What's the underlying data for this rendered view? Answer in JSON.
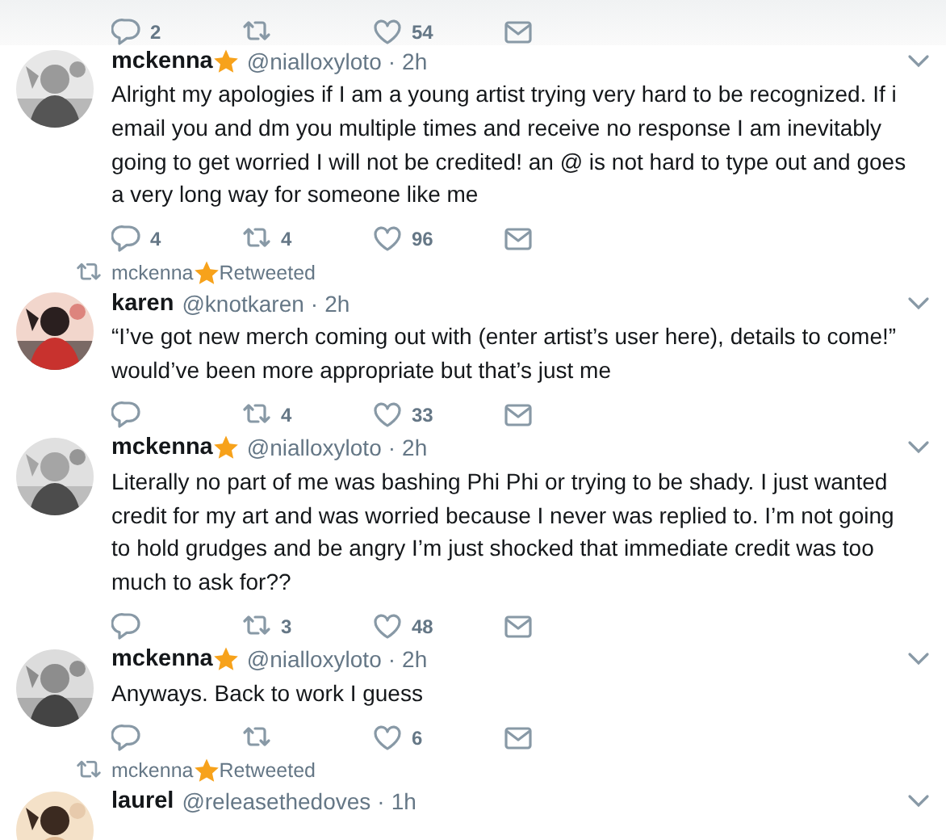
{
  "timeline": [
    {
      "kind": "actions",
      "actions": [
        {
          "kind": "reply",
          "count": "2"
        },
        {
          "kind": "retweet"
        },
        {
          "kind": "like",
          "count": "54"
        },
        {
          "kind": "message"
        }
      ]
    },
    {
      "kind": "tweet",
      "name": "mckenna",
      "star": true,
      "handle": "@nialloxyloto",
      "separator": "·",
      "time": "2h",
      "text": "Alright my apologies if I am a young artist trying very hard to be recognized. If i email you and dm you multiple times and receive no response I am inevitably going to get worried I will not be credited! an @ is not hard to type out and goes a very long way for someone like me",
      "actions": [
        {
          "kind": "reply",
          "count": "4"
        },
        {
          "kind": "retweet",
          "count": "4"
        },
        {
          "kind": "like",
          "count": "96"
        },
        {
          "kind": "message"
        }
      ]
    },
    {
      "kind": "retweet_notice",
      "name": "mckenna",
      "star": true,
      "label": "Retweeted"
    },
    {
      "kind": "tweet",
      "name": "karen",
      "star": false,
      "handle": "@knotkaren",
      "separator": "·",
      "time": "2h",
      "text": "“I’ve got new merch coming out with (enter artist’s user here), details to come!” would’ve been more appropriate but that’s just me",
      "actions": [
        {
          "kind": "reply"
        },
        {
          "kind": "retweet",
          "count": "4"
        },
        {
          "kind": "like",
          "count": "33"
        },
        {
          "kind": "message"
        }
      ]
    },
    {
      "kind": "tweet",
      "name": "mckenna",
      "star": true,
      "handle": "@nialloxyloto",
      "separator": "·",
      "time": "2h",
      "text": "Literally no part of me was bashing Phi Phi or trying to be shady. I just wanted credit for my art and was worried because I never was replied to. I’m not going to hold grudges and be angry I’m just shocked that immediate credit was too much to ask for??",
      "actions": [
        {
          "kind": "reply"
        },
        {
          "kind": "retweet",
          "count": "3"
        },
        {
          "kind": "like",
          "count": "48"
        },
        {
          "kind": "message"
        }
      ]
    },
    {
      "kind": "tweet",
      "name": "mckenna",
      "star": true,
      "handle": "@nialloxyloto",
      "separator": "·",
      "time": "2h",
      "text": "Anyways. Back to work I guess",
      "actions": [
        {
          "kind": "reply"
        },
        {
          "kind": "retweet"
        },
        {
          "kind": "like",
          "count": "6"
        },
        {
          "kind": "message"
        }
      ]
    },
    {
      "kind": "retweet_notice",
      "name": "mckenna",
      "star": true,
      "label": "Retweeted"
    },
    {
      "kind": "tweet",
      "name": "laurel",
      "star": false,
      "handle": "@releasethedoves",
      "separator": "·",
      "time": "1h"
    }
  ]
}
